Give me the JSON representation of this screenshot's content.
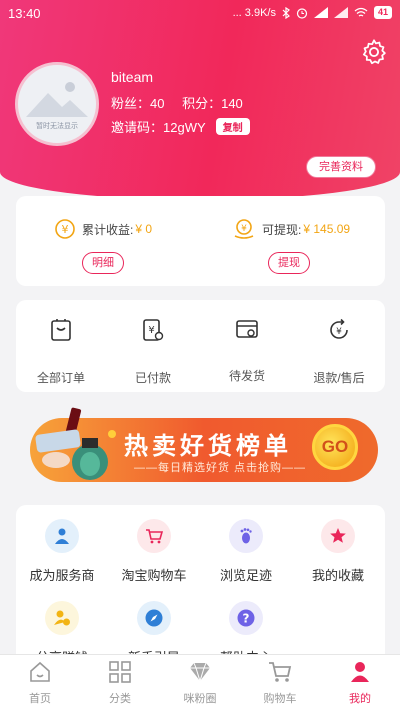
{
  "status_bar": {
    "time": "13:40",
    "right_text": "... 3.9K/s",
    "battery": "41"
  },
  "profile": {
    "avatar_placeholder_text": "暂时无法显示",
    "username": "biteam",
    "fans_label": "粉丝：40",
    "points_label": "积分：140",
    "invite_label": "邀请码：12gWY",
    "copy_button": "复制",
    "complete_profile_button": "完善资料"
  },
  "earnings": {
    "total_label": "累计收益:",
    "total_value": "¥ 0",
    "withdrawable_label": "可提现:",
    "withdrawable_value": "¥ 145.09",
    "detail_button": "明细",
    "withdraw_button": "提现"
  },
  "orders": [
    {
      "label": "全部订单",
      "icon": "all-orders-icon"
    },
    {
      "label": "已付款",
      "icon": "paid-icon"
    },
    {
      "label": "待发货",
      "icon": "pending-shipment-icon"
    },
    {
      "label": "退款/售后",
      "icon": "refund-icon"
    }
  ],
  "banner": {
    "title": "热卖好货榜单",
    "subtitle": "——每日精选好货 点击抢购——",
    "go_text": "GO"
  },
  "services": [
    {
      "label": "成为服务商",
      "icon": "service-provider-icon",
      "bg": "#e3f0fb"
    },
    {
      "label": "淘宝购物车",
      "icon": "taobao-cart-icon",
      "bg": "#fde8ea"
    },
    {
      "label": "浏览足迹",
      "icon": "footprint-icon",
      "bg": "#ecebfb"
    },
    {
      "label": "我的收藏",
      "icon": "favorites-icon",
      "bg": "#fde8ea"
    },
    {
      "label": "分享赚钱",
      "icon": "share-earn-icon",
      "bg": "#fdf6dc"
    },
    {
      "label": "新手引导",
      "icon": "guide-icon",
      "bg": "#e3f0fb"
    },
    {
      "label": "帮助中心",
      "icon": "help-icon",
      "bg": "#ecebfb"
    }
  ],
  "tabbar": [
    {
      "label": "首页",
      "icon": "home-icon"
    },
    {
      "label": "分类",
      "icon": "category-icon"
    },
    {
      "label": "咪粉圈",
      "icon": "diamond-icon"
    },
    {
      "label": "购物车",
      "icon": "cart-icon"
    },
    {
      "label": "我的",
      "icon": "profile-icon",
      "active": true
    }
  ],
  "colors": {
    "brand": "#e9265a",
    "gold": "#f2a514"
  }
}
